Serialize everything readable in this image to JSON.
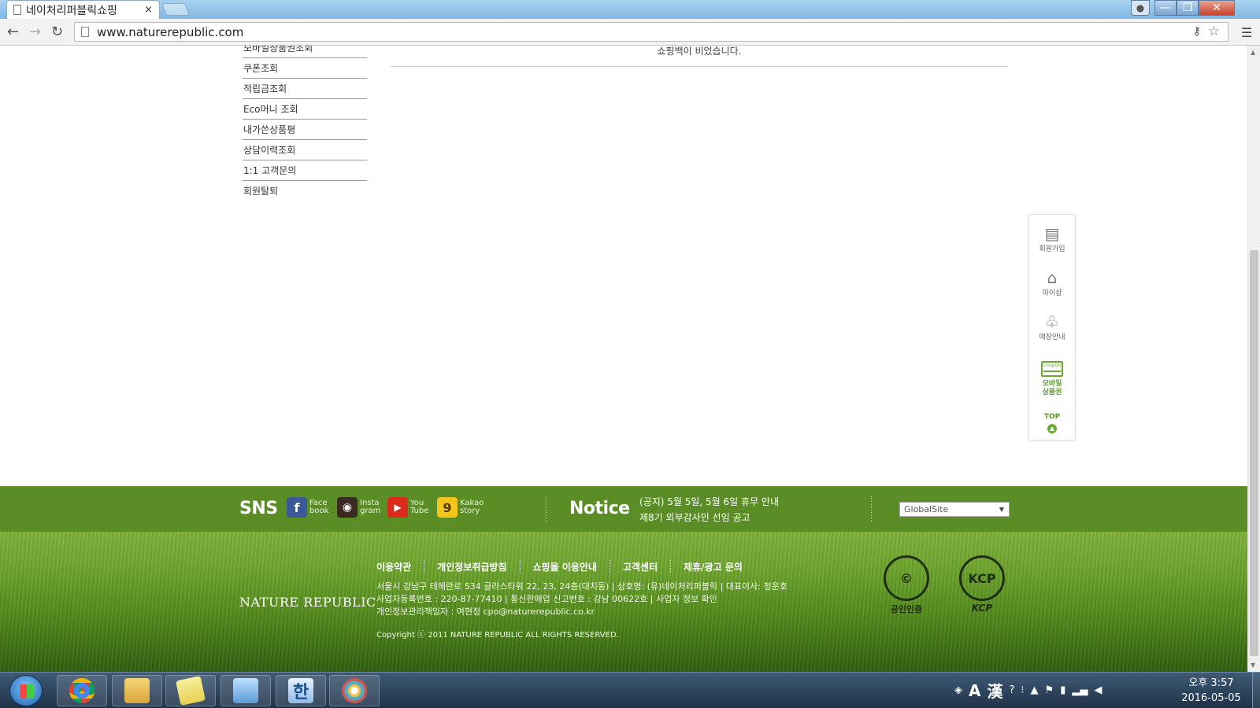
{
  "browser": {
    "tab_title": "네이처리퍼블릭쇼핑",
    "tab_close": "×",
    "url": "www.naturerepublic.com",
    "profile_icon": "person-icon",
    "minimize_label": "—",
    "maximize_label": "❐",
    "close_label": "✕"
  },
  "page": {
    "menu_items": [
      "모바일상품권조회",
      "쿠폰조회",
      "적립금조회",
      "Eco머니 조회",
      "내가쓴상품평",
      "상담이력조회",
      "1:1 고객문의",
      "회원탈퇴"
    ],
    "empty_message": "쇼핑백이 비었습니다."
  },
  "quick_menu": {
    "join": "회원가입",
    "myshop": "마이샵",
    "store": "매장안내",
    "mobile_voucher_1": "모바일",
    "mobile_voucher_2": "상품권",
    "coupon_icon_text": "coupon",
    "top": "TOP"
  },
  "footer": {
    "sns_title": "SNS",
    "sns": [
      {
        "l1": "Face",
        "l2": "book",
        "icon": "facebook-icon",
        "glyph": "f"
      },
      {
        "l1": "Insta",
        "l2": "gram",
        "icon": "instagram-icon",
        "glyph": "◉"
      },
      {
        "l1": "You",
        "l2": "Tube",
        "icon": "youtube-icon",
        "glyph": "▶"
      },
      {
        "l1": "Kakao",
        "l2": "story",
        "icon": "kakaostory-icon",
        "glyph": "9"
      }
    ],
    "notice_title": "Notice",
    "notices": [
      "(공지) 5월 5일, 5월 6일 휴무 안내",
      "제8기 외부감사인 선임 공고"
    ],
    "global_site": "GlobalSite",
    "brand": "NATURE REPUBLIC",
    "links": [
      "이용약관",
      "개인정보취급방침",
      "쇼핑몰 이용안내",
      "고객센터",
      "제휴/광고 문의"
    ],
    "info_line1": "서울시 강남구 테헤란로 534 글라스타워 22, 23, 24층(대치동) | 상호명: (유)네이처리퍼블릭 | 대표이사: 정운호",
    "info_line2": "사업자등록번호 : 220-87-77410 | 통신판매업 신고번호 : 강남 00622호 | 사업자 정보 확인",
    "info_line3": "개인정보관리책임자 : 여현정 cpo@naturerepublic.co.kr",
    "copyright": "Copyright ⓒ 2011 NATURE REPUBLIC ALL RIGHTS RESERVED.",
    "cert1_caption": "공인인증",
    "cert2_caption": "KCP",
    "cert2_seal": "KCP"
  },
  "taskbar": {
    "tray_ime_a": "A",
    "tray_ime_han": "漢",
    "tray_help": "?",
    "clock_time": "오후 3:57",
    "clock_date": "2016-05-05"
  },
  "colors": {
    "footer_green": "#5a8d26",
    "menu_divider": "#7ab648",
    "accent_green": "#6aaa34"
  }
}
